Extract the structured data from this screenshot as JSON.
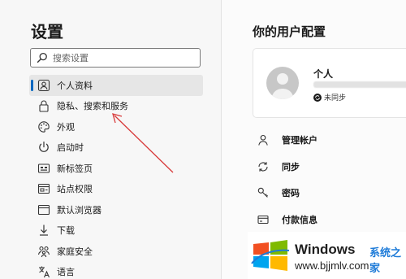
{
  "sidebar": {
    "title": "设置",
    "search": {
      "placeholder": "搜索设置",
      "value": ""
    },
    "items": [
      {
        "label": "个人资料",
        "icon": "person-icon",
        "active": true
      },
      {
        "label": "隐私、搜索和服务",
        "icon": "lock-icon",
        "active": false
      },
      {
        "label": "外观",
        "icon": "palette-icon",
        "active": false
      },
      {
        "label": "启动时",
        "icon": "power-icon",
        "active": false
      },
      {
        "label": "新标签页",
        "icon": "new-tab-icon",
        "active": false
      },
      {
        "label": "站点权限",
        "icon": "site-permissions-icon",
        "active": false
      },
      {
        "label": "默认浏览器",
        "icon": "browser-window-icon",
        "active": false
      },
      {
        "label": "下载",
        "icon": "download-icon",
        "active": false
      },
      {
        "label": "家庭安全",
        "icon": "family-icon",
        "active": false
      },
      {
        "label": "语言",
        "icon": "language-icon",
        "active": false
      }
    ]
  },
  "main": {
    "title": "你的用户配置",
    "profile": {
      "name": "个人",
      "sync_status": "未同步"
    },
    "menu": [
      {
        "label": "管理帐户",
        "icon": "person-icon"
      },
      {
        "label": "同步",
        "icon": "sync-icon"
      },
      {
        "label": "密码",
        "icon": "key-icon"
      },
      {
        "label": "付款信息",
        "icon": "card-icon"
      }
    ]
  },
  "watermark": {
    "title": "Windows",
    "subtitle": "系统之家",
    "url": "www.bjjmlv.com"
  },
  "colors": {
    "accent": "#0067c0",
    "annotation_arrow": "#d83a3a",
    "watermark_blue": "#1e7bd8"
  }
}
